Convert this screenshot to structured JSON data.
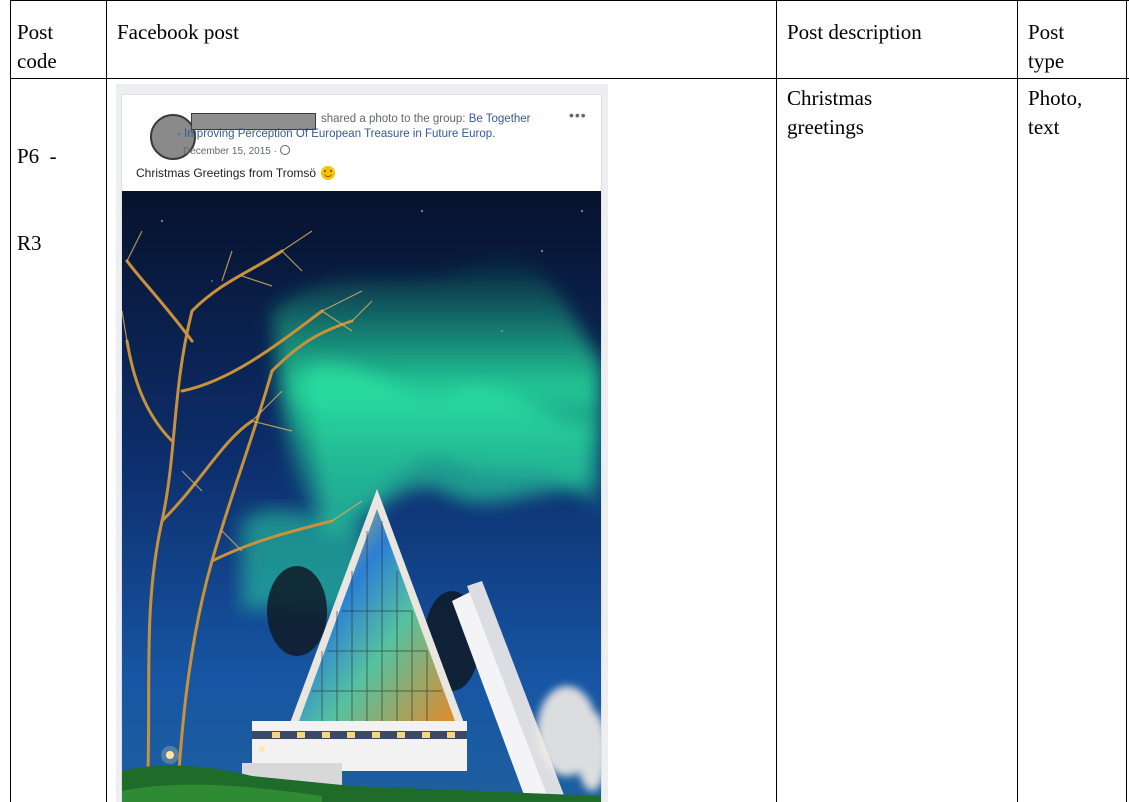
{
  "table": {
    "headers": [
      "Post code",
      "Facebook post",
      "Post description",
      "Post type"
    ],
    "header_lines": {
      "code": [
        "Post",
        "code"
      ],
      "post": "Facebook post",
      "description": "Post description",
      "type": [
        "Post",
        "type"
      ]
    },
    "row": {
      "code_lines": [
        "P6  -",
        "R3"
      ],
      "description_lines": [
        "Christmas",
        "greetings"
      ],
      "type_lines": [
        "Photo,",
        "text"
      ]
    }
  },
  "facebook_post": {
    "shared_prefix": "shared a photo to the group:",
    "group_name_part1": "Be Together",
    "group_name_part2": "- Improving Perception Of European Treasure in Future Europ.",
    "more_icon": "•••",
    "date": "December 15, 2015 ·",
    "caption": "Christmas Greetings from Tromsö",
    "author_name_redacted": true,
    "photo_subject": "arctic-cathedral-northern-lights"
  },
  "colors": {
    "link": "#385898",
    "meta": "#606770",
    "sky_top": "#06122e",
    "aurora": "#2fe39a"
  }
}
